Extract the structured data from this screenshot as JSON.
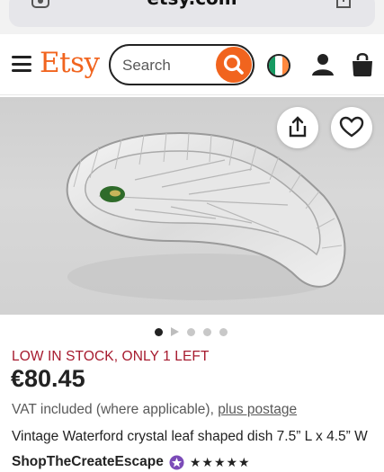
{
  "browser": {
    "url": "etsy.com",
    "left_icon": "page-settings-icon",
    "right_icon": "share-icon"
  },
  "header": {
    "logo": "Etsy",
    "search_placeholder": "Search",
    "colors": {
      "brand": "#f1641e"
    }
  },
  "product": {
    "image_alt": "crystal leaf shaped dish",
    "carousel": {
      "count": 5,
      "active": 1,
      "has_video": true
    },
    "stock_notice": "LOW IN STOCK, ONLY 1 LEFT",
    "price": "€80.45",
    "vat_text": "VAT included (where applicable),",
    "postage_link": "plus postage",
    "title": "Vintage Waterford crystal leaf shaped dish 7.5” L x 4.5” W",
    "shop_name": "ShopTheCreateEscape",
    "rating_stars": "★★★★★",
    "rating": 5
  }
}
